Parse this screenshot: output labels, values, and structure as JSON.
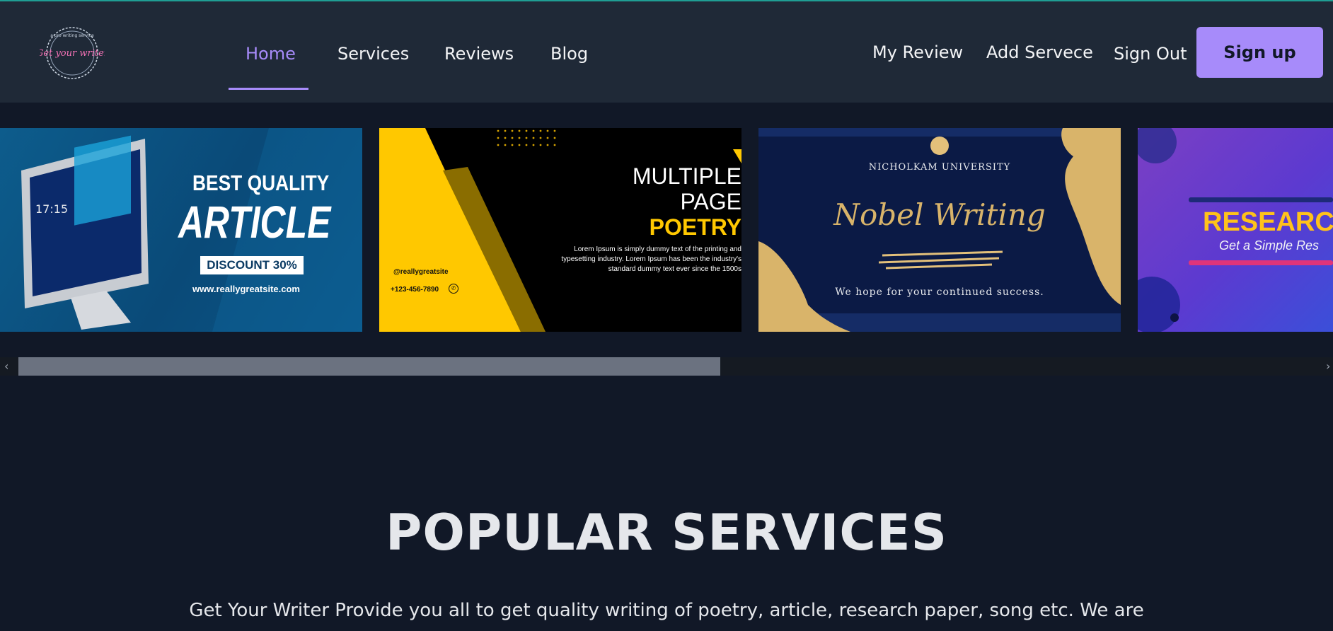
{
  "brand": {
    "logo_text": "Get your writer",
    "logo_arc_text": "a pro writing service"
  },
  "nav": {
    "left": [
      {
        "label": "Home",
        "active": true
      },
      {
        "label": "Services"
      },
      {
        "label": "Reviews"
      },
      {
        "label": "Blog"
      }
    ],
    "right": [
      {
        "label": "My Review"
      },
      {
        "label": "Add Servece"
      },
      {
        "label": "Sign Out"
      }
    ],
    "signup_label": "Sign up"
  },
  "slides": {
    "s1": {
      "line1": "BEST QUALITY",
      "line2": "ARTICLE",
      "badge": "DISCOUNT 30%",
      "url": "www.reallygreatsite.com",
      "clock": "17:15"
    },
    "s2": {
      "line1": "MULTIPLE",
      "line2": "PAGE",
      "line3": "POETRY",
      "body1": "Lorem Ipsum is simply dummy text of the printing and",
      "body2": "typesetting industry. Lorem Ipsum has been the industry's",
      "body3": "standard dummy text ever since the 1500s",
      "handle": "@reallygreatsite",
      "phone": "+123-456-7890"
    },
    "s3": {
      "university": "NICHOLKAM UNIVERSITY",
      "script": "Nobel Writing",
      "tagline": "We hope for your continued success."
    },
    "s4": {
      "title": "RESEARCH",
      "subtitle": "Get a Simple Res"
    }
  },
  "popular": {
    "title": "POPULAR SERVICES",
    "desc": "Get Your Writer Provide you all to get quality writing of poetry, article, research paper, song etc. We are"
  },
  "colors": {
    "accent": "#a78bfa",
    "nav_bg": "#1f2937",
    "page_bg": "#111827",
    "poetry_yellow": "#ffc800"
  }
}
